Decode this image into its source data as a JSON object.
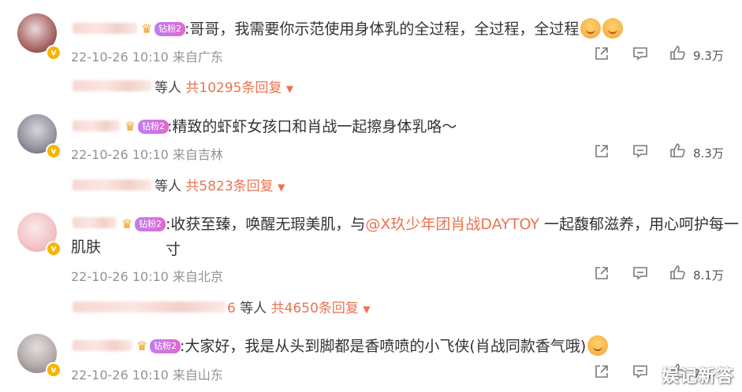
{
  "comments": [
    {
      "fan_label": "钻粉2",
      "text": ":哥哥，我需要你示范使用身体乳的全过程，全过程，全过程",
      "time": "22-10-26 10:10",
      "location": "来自广东",
      "likes": "9.3万",
      "replies_who": "等人",
      "replies_total": "共10295条回复"
    },
    {
      "fan_label": "钻粉2",
      "text": ":精致的虾虾女孩口和肖战一起擦身体乳咯～",
      "time": "22-10-26 10:10",
      "location": "来自吉林",
      "likes": "8.3万",
      "replies_who": "等人",
      "replies_total": "共5823条回复"
    },
    {
      "fan_label": "钻粉2",
      "text_pre": ":收获至臻，唤醒无瑕美肌，与",
      "mention": "@X玖少年团肖战DAYTOY",
      "text_post": " 一起馥郁滋养，用心呵护每一寸",
      "text_line2": "肌肤",
      "time": "22-10-26 10:10",
      "location": "来自北京",
      "likes": "8.1万",
      "replies_suffix": "6",
      "replies_who": "等人",
      "replies_total": "共4650条回复"
    },
    {
      "fan_label": "钻粉2",
      "text": ":大家好，我是从头到脚都是香喷喷的小飞侠(肖战同款香气哦)",
      "time": "22-10-26 10:10",
      "location": "来自山东",
      "likes": "7万"
    }
  ],
  "icons": {
    "share": "share-icon",
    "comment": "comment-icon",
    "like": "thumbs-up-icon",
    "verified": "verified-icon",
    "crown": "crown-icon",
    "caret": "caret-down-icon"
  },
  "watermark": "娱记新答",
  "colors": {
    "accent": "#eb7350",
    "meta": "#939393",
    "verified": "#f7b500"
  }
}
